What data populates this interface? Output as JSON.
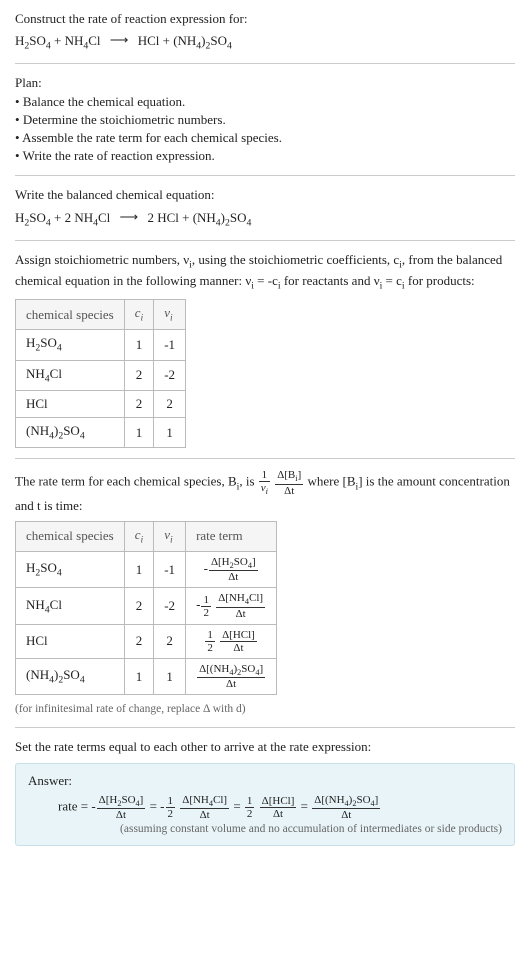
{
  "header": {
    "title": "Construct the rate of reaction expression for:"
  },
  "plan": {
    "label": "Plan:",
    "items": [
      "Balance the chemical equation.",
      "Determine the stoichiometric numbers.",
      "Assemble the rate term for each chemical species.",
      "Write the rate of reaction expression."
    ]
  },
  "balanced": {
    "label": "Write the balanced chemical equation:"
  },
  "assign": {
    "text1": "Assign stoichiometric numbers, ν",
    "text2": ", using the stoichiometric coefficients, c",
    "text3": ", from the balanced chemical equation in the following manner: ν",
    "text4": " = -c",
    "text5": " for reactants and ν",
    "text6": " = c",
    "text7": " for products:"
  },
  "table1": {
    "h1": "chemical species",
    "h2": "cᵢ",
    "h3": "νᵢ",
    "rows": [
      {
        "s": "H2SO4",
        "c": "1",
        "v": "-1"
      },
      {
        "s": "NH4Cl",
        "c": "2",
        "v": "-2"
      },
      {
        "s": "HCl",
        "c": "2",
        "v": "2"
      },
      {
        "s": "(NH4)2SO4",
        "c": "1",
        "v": "1"
      }
    ]
  },
  "rateterm": {
    "t1": "The rate term for each chemical species, B",
    "t2": ", is ",
    "t3": " where [B",
    "t4": "] is the amount concentration and t is time:"
  },
  "table2": {
    "h1": "chemical species",
    "h2": "cᵢ",
    "h3": "νᵢ",
    "h4": "rate term"
  },
  "infinitesimal": "(for infinitesimal rate of change, replace Δ with d)",
  "final": {
    "label": "Set the rate terms equal to each other to arrive at the rate expression:"
  },
  "answer": {
    "label": "Answer:",
    "prefix": "rate = ",
    "note": "(assuming constant volume and no accumulation of intermediates or side products)"
  }
}
